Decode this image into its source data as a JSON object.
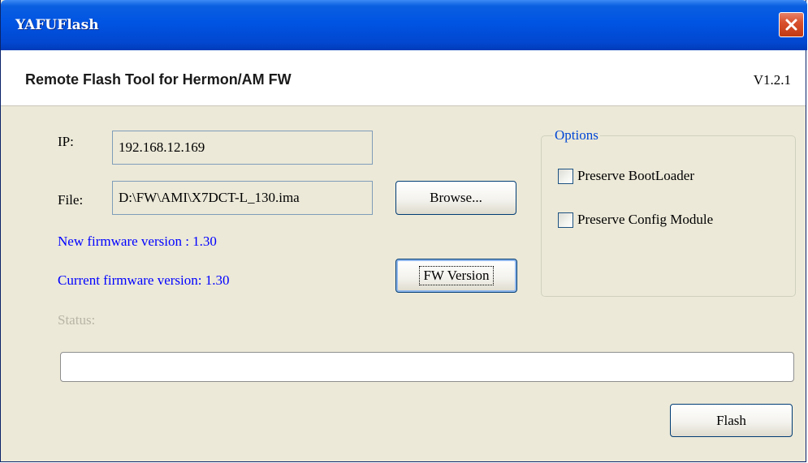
{
  "window": {
    "title": "YAFUFlash",
    "close_icon": "close-icon"
  },
  "header": {
    "title": "Remote Flash Tool for Hermon/AM FW",
    "version": "V1.2.1"
  },
  "form": {
    "ip_label": "IP:",
    "ip_value": "192.168.12.169",
    "file_label": "File:",
    "file_value": "D:\\FW\\AMI\\X7DCT-L_130.ima",
    "browse_label": "Browse...",
    "new_fw_text": "New firmware version : 1.30",
    "current_fw_text": "Current firmware version: 1.30",
    "fw_version_button": "FW Version",
    "status_label": "Status:"
  },
  "options": {
    "title": "Options",
    "items": [
      {
        "label": "Preserve BootLoader",
        "checked": false
      },
      {
        "label": "Preserve Config Module",
        "checked": false
      }
    ]
  },
  "progress": {
    "value": 0
  },
  "actions": {
    "flash_label": "Flash"
  },
  "colors": {
    "titlebar": "#0054e3",
    "window_bg": "#ece9d8",
    "info_text": "#0000ff",
    "group_title": "#0046d5",
    "close_button": "#c23a12"
  }
}
